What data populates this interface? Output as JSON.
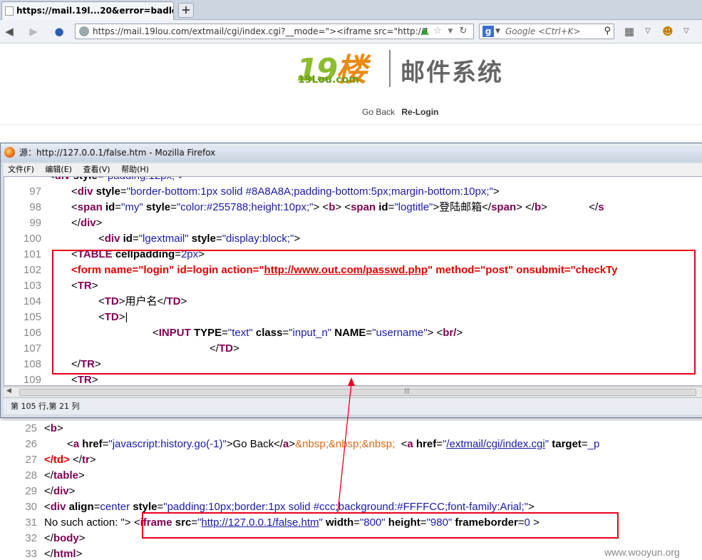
{
  "browser": {
    "tab_title": "https://mail.19l...20&error=badlogi",
    "new_tab": "+",
    "url": "https://mail.19lou.com/extmail/cgi/index.cgi?__mode=\"><iframe src=\"http://1",
    "search_placeholder": "Google <Ctrl+K>",
    "search_engine": "g"
  },
  "page": {
    "logo_big": "19",
    "logo_char": "楼",
    "logo_small": "19Lou.com",
    "system_name": "邮件系统",
    "go_back": "Go Back",
    "relogin": "Re-Login"
  },
  "source_window": {
    "title": "源：http://127.0.0.1/false.htm - Mozilla Firefox",
    "menu": [
      "文件(F)",
      "编辑(E)",
      "查看(V)",
      "帮助(H)"
    ],
    "status": "第 105 行,第 21 列",
    "line_numbers": [
      "97",
      "98",
      "99",
      "100",
      "101",
      "102",
      "103",
      "104",
      "105",
      "106",
      "107",
      "108",
      "109"
    ]
  },
  "bottom_source": {
    "line_numbers": [
      "25",
      "26",
      "27",
      "28",
      "29",
      "30",
      "31",
      "32",
      "33"
    ],
    "watermark": "www.wooyun.org"
  },
  "colors": {
    "tag": "#7f0055",
    "value": "#1a1aa6",
    "highlight": "#e00000",
    "annotation": "#e8001c"
  }
}
